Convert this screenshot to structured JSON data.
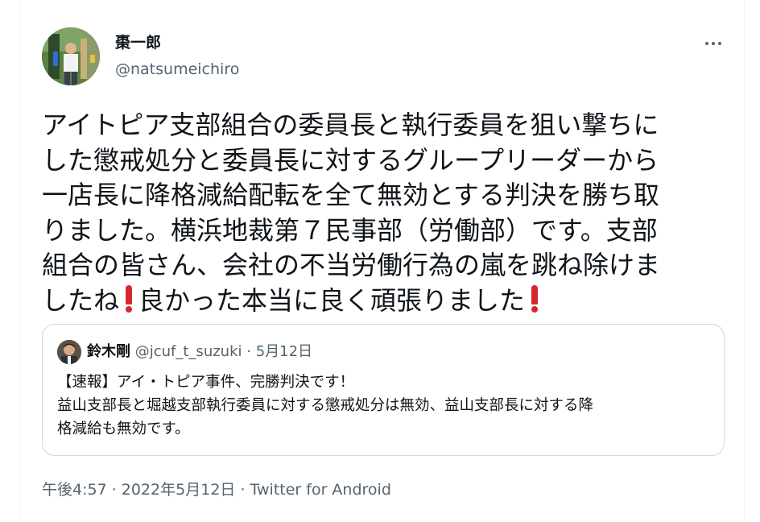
{
  "author": {
    "name": "棗一郎",
    "handle": "@natsumeichiro"
  },
  "more_icon": "more-horizontal-icon",
  "tweet": {
    "lines": [
      "アイトピア支部組合の委員長と執行委員を狙い撃ちに",
      "した懲戒処分と委員長に対するグループリーダーから",
      "一店長に降格減給配転を全て無効とする判決を勝ち取",
      "りました。横浜地裁第７民事部（労働部）です。支部",
      "組合の皆さん、会社の不当労働行為の嵐を跳ね除けま"
    ],
    "last_line_part1": "したね",
    "last_line_part2": "良かった本当に良く頑張りました",
    "emoji": "heavy-exclamation-mark-icon",
    "emoji_color": "#d7262f"
  },
  "quote": {
    "name": "鈴木剛",
    "handle": "@jcuf_t_suzuki",
    "separator": " · ",
    "date": "5月12日",
    "lines": [
      "【速報】アイ・トピア事件、完勝判決です！",
      "益山支部長と堀越支部執行委員に対する懲戒処分は無効、益山支部長に対する降",
      "格減給も無効です。"
    ]
  },
  "footer": {
    "time": "午後4:57",
    "sep1": " · ",
    "date": "2022年5月12日",
    "sep2": " · ",
    "source": "Twitter for Android"
  },
  "colors": {
    "text": "#0f1419",
    "secondary": "#536471",
    "border": "#cfd9de"
  }
}
